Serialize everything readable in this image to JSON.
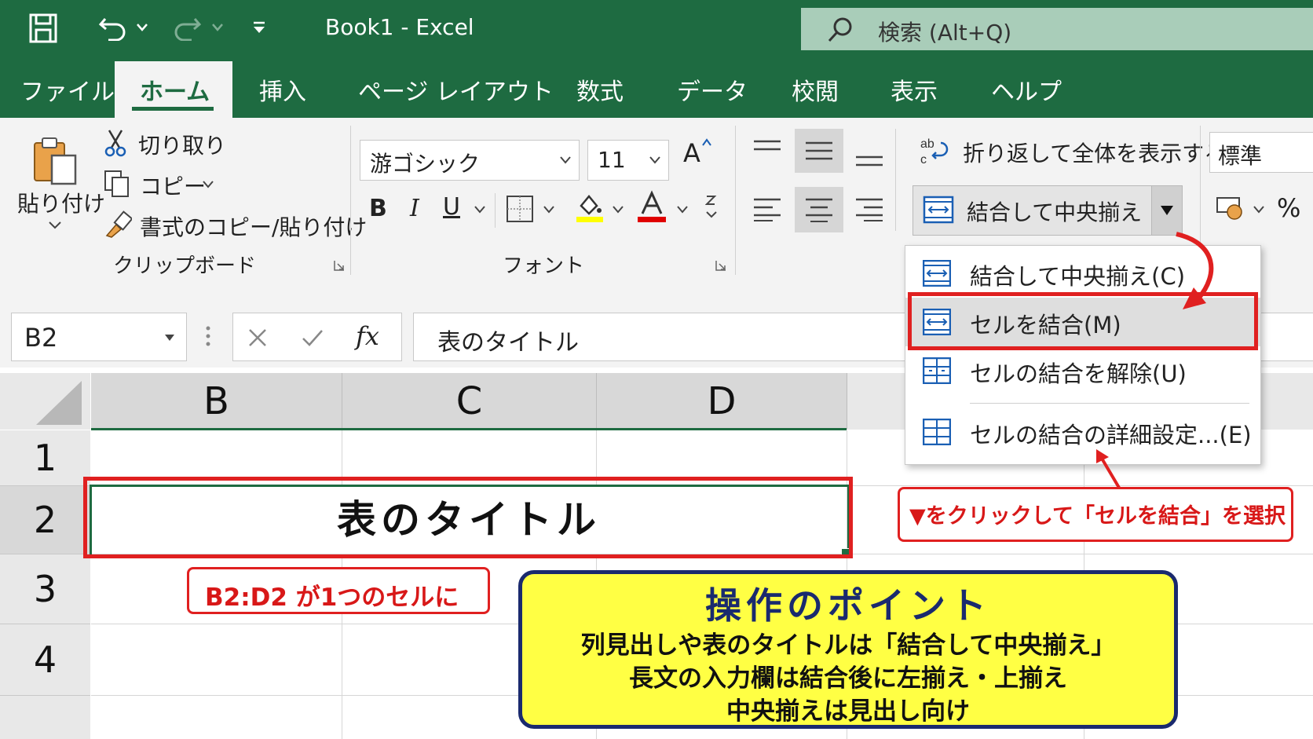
{
  "titlebar": {
    "title": "Book1  -  Excel",
    "search_placeholder": "検索 (Alt+Q)"
  },
  "tabs": [
    "ファイル",
    "ホーム",
    "挿入",
    "ページ レイアウト",
    "数式",
    "データ",
    "校閲",
    "表示",
    "ヘルプ"
  ],
  "active_tab": "ホーム",
  "clipboard": {
    "paste_label": "貼り付け",
    "cut_label": "切り取り",
    "copy_label": "コピー",
    "format_painter_label": "書式のコピー/貼り付け",
    "group_label": "クリップボード"
  },
  "font": {
    "font_name": "游ゴシック",
    "font_size": "11",
    "group_label": "フォント",
    "bold": "B",
    "italic": "I",
    "underline": "U",
    "grow": "A"
  },
  "alignment": {
    "wrap_text_label": "折り返して全体を表示する",
    "merge_center_label": "結合して中央揃え"
  },
  "number": {
    "format": "標準",
    "percent": "%"
  },
  "merge_menu": {
    "items": [
      {
        "label": "結合して中央揃え(C)",
        "accel": "C"
      },
      {
        "label": "セルを結合(M)",
        "accel": "M"
      },
      {
        "label": "セルの結合を解除(U)",
        "accel": "U"
      },
      {
        "label": "セルの結合の詳細設定...(E)",
        "accel": "E"
      }
    ],
    "highlighted_index": 1
  },
  "formula_bar": {
    "name_box": "B2",
    "fx": "fx",
    "content": "表のタイトル"
  },
  "sheet": {
    "columns": [
      "B",
      "C",
      "D"
    ],
    "rows": [
      "1",
      "2",
      "3",
      "4"
    ],
    "b2_value": "表のタイトル"
  },
  "annotations": {
    "merged_note": "B2:D2 が1つのセルに",
    "click_instruction": "▼をクリックして「セルを結合」を選択",
    "point_title": "操作のポイント",
    "point_lines": [
      "列見出しや表のタイトルは「結合して中央揃え」",
      "長文の入力欄は結合後に左揃え・上揃え",
      "中央揃えは見出し向け"
    ]
  },
  "colors": {
    "excel_green": "#1e6b41",
    "highlight_red": "#e02020",
    "point_yellow": "#ffff44",
    "point_border": "#1a2a6e"
  }
}
